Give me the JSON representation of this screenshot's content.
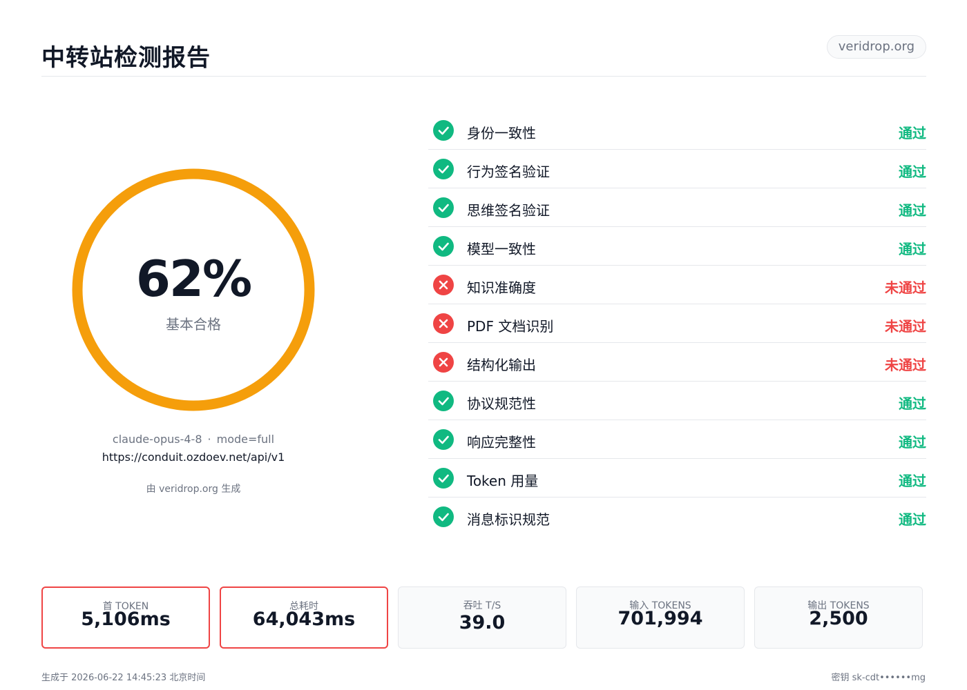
{
  "header": {
    "title": "中转站检测报告",
    "domain": "veridrop.org"
  },
  "score": {
    "value": "62%",
    "percent": 62,
    "label": "基本合格",
    "ring_color": "#f59e0b"
  },
  "meta": {
    "model": "claude-opus-4-8",
    "separator": "·",
    "mode": "mode=full",
    "endpoint": "https://conduit.ozdoev.net/api/v1",
    "generated_by": "由 veridrop.org 生成"
  },
  "checks": [
    {
      "name": "身份一致性",
      "result": "通过",
      "status": "pass"
    },
    {
      "name": "行为签名验证",
      "result": "通过",
      "status": "pass"
    },
    {
      "name": "思维签名验证",
      "result": "通过",
      "status": "pass"
    },
    {
      "name": "模型一致性",
      "result": "通过",
      "status": "pass"
    },
    {
      "name": "知识准确度",
      "result": "未通过",
      "status": "fail"
    },
    {
      "name": "PDF 文档识别",
      "result": "未通过",
      "status": "fail"
    },
    {
      "name": "结构化输出",
      "result": "未通过",
      "status": "fail"
    },
    {
      "name": "协议规范性",
      "result": "通过",
      "status": "pass"
    },
    {
      "name": "响应完整性",
      "result": "通过",
      "status": "pass"
    },
    {
      "name": "Token 用量",
      "result": "通过",
      "status": "pass"
    },
    {
      "name": "消息标识规范",
      "result": "通过",
      "status": "pass"
    }
  ],
  "stats": [
    {
      "label": "首 TOKEN",
      "value": "5,106ms",
      "alert": true
    },
    {
      "label": "总耗时",
      "value": "64,043ms",
      "alert": true
    },
    {
      "label": "吞吐 T/S",
      "value": "39.0",
      "alert": false
    },
    {
      "label": "输入 TOKENS",
      "value": "701,994",
      "alert": false
    },
    {
      "label": "输出 TOKENS",
      "value": "2,500",
      "alert": false
    }
  ],
  "footer": {
    "generated_at": "生成于 2026-06-22 14:45:23 北京时间",
    "key": "密钥 sk-cdt••••••mg"
  },
  "colors": {
    "pass": "#10b981",
    "fail": "#ef4444",
    "accent": "#f59e0b"
  },
  "icons": {
    "pass": "check-circle-icon",
    "fail": "x-circle-icon"
  }
}
